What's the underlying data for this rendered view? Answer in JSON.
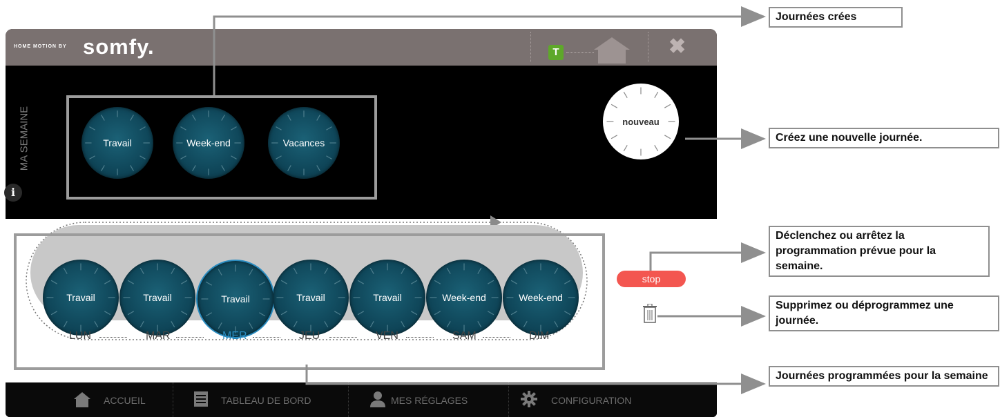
{
  "brand": {
    "prefix": "HOME MOTION BY",
    "name": "somfy."
  },
  "titlebar": {
    "t_badge": "T",
    "close_glyph": "✖"
  },
  "section_label": "MA SEMAINE",
  "created_days": [
    "Travail",
    "Week-end",
    "Vacances"
  ],
  "new_day_button": "nouveau",
  "week": {
    "days": [
      {
        "day": "LUN",
        "program": "Travail"
      },
      {
        "day": "MAR",
        "program": "Travail"
      },
      {
        "day": "MER",
        "program": "Travail",
        "selected": true
      },
      {
        "day": "JEU",
        "program": "Travail"
      },
      {
        "day": "VEN",
        "program": "Travail"
      },
      {
        "day": "SAM",
        "program": "Week-end"
      },
      {
        "day": "DIM",
        "program": "Week-end"
      }
    ],
    "selected_color": "#2a8cc0"
  },
  "stop_button": "stop",
  "info_glyph": "i",
  "navbar": {
    "items": [
      "ACCUEIL",
      "TABLEAU DE BORD",
      "MES RÉGLAGES",
      "CONFIGURATION"
    ]
  },
  "annotations": {
    "created_days": "Journées crées",
    "new_day": "Créez une nouvelle journée.",
    "start_stop": "Déclenchez ou arrêtez la programmation prévue pour la semaine.",
    "delete": "Supprimez ou déprogrammez une journée.",
    "scheduled": "Journées programmées pour la semaine"
  },
  "colors": {
    "accent_green": "#5ea82a",
    "stop_red": "#f35650",
    "dial_teal": "#0f4659"
  }
}
